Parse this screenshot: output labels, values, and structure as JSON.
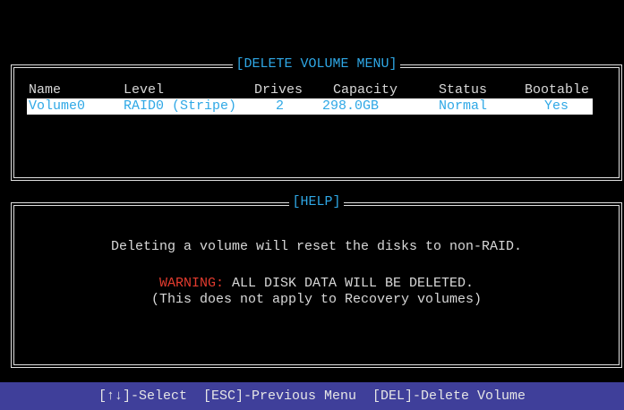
{
  "delete_menu": {
    "title": "[DELETE VOLUME MENU]",
    "headers": [
      "Name",
      "Level",
      "Drives",
      "Capacity",
      "Status",
      "Bootable"
    ],
    "rows": [
      {
        "name": "Volume0",
        "level": "RAID0 (Stripe)",
        "drives": "2",
        "capacity": "298.0GB",
        "status": "Normal",
        "bootable": "Yes"
      }
    ]
  },
  "help": {
    "title": "[HELP]",
    "line1": "Deleting a volume will reset the disks to non-RAID.",
    "warning_label": "WARNING:",
    "warning_text": " ALL DISK DATA WILL BE DELETED.",
    "line3": "(This does not apply to Recovery volumes)"
  },
  "footer": {
    "select": "[↑↓]-Select",
    "esc": "[ESC]-Previous Menu",
    "del": "[DEL]-Delete Volume"
  },
  "colors": {
    "background": "#000000",
    "title_blue": "#2fa8e6",
    "warning_red": "#e23b2e",
    "footer_bg": "#3f3f9a"
  }
}
